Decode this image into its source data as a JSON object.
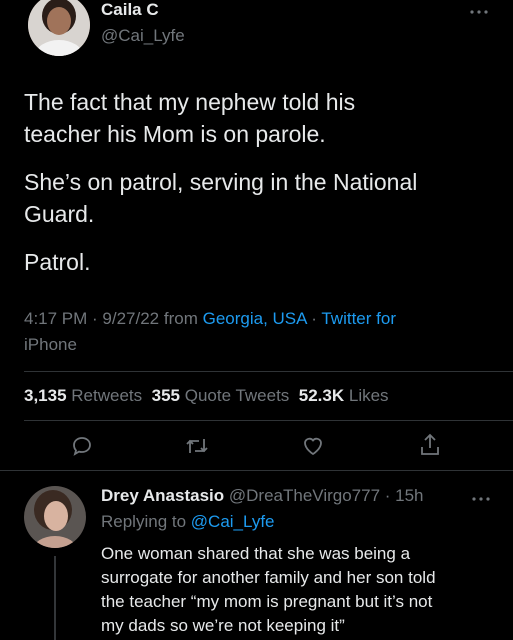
{
  "tweet": {
    "author_name": "Caila C",
    "author_handle": "@Cai_Lyfe",
    "more_icon": "more-horizontal-icon",
    "lines": [
      "The fact that my nephew told his",
      "teacher his Mom is on parole.",
      "She’s on patrol, serving in the National",
      "Guard.",
      "Patrol."
    ],
    "time": "4:17 PM · 9/27/22 from ",
    "location": "Georgia, USA",
    "separator": " · ",
    "source_1": "Twitter for",
    "source_2": "iPhone",
    "stats": {
      "retweets_count": "3,135",
      "retweets_label": "Retweets",
      "quotes_count": "355",
      "quotes_label": "Quote Tweets",
      "likes_count": "52.3K",
      "likes_label": "Likes"
    },
    "actions": [
      "reply-icon",
      "retweet-icon",
      "like-icon",
      "share-icon"
    ]
  },
  "reply": {
    "author_name": "Drey Anastasio",
    "author_handle": "@DreaTheVirgo777",
    "time": " · 15h",
    "replying_prefix": "Replying to ",
    "replying_handle": "@Cai_Lyfe",
    "lines": [
      "One woman shared that she was being a",
      "surrogate for another family and her son told",
      "the teacher “my mom is pregnant but it’s not",
      "my dads so we’re not keeping it”"
    ]
  },
  "colors": {
    "background": "#000000",
    "text": "#e7e9ea",
    "secondary": "#71767b",
    "accent": "#1d9bf0",
    "divider": "#2f3336"
  }
}
